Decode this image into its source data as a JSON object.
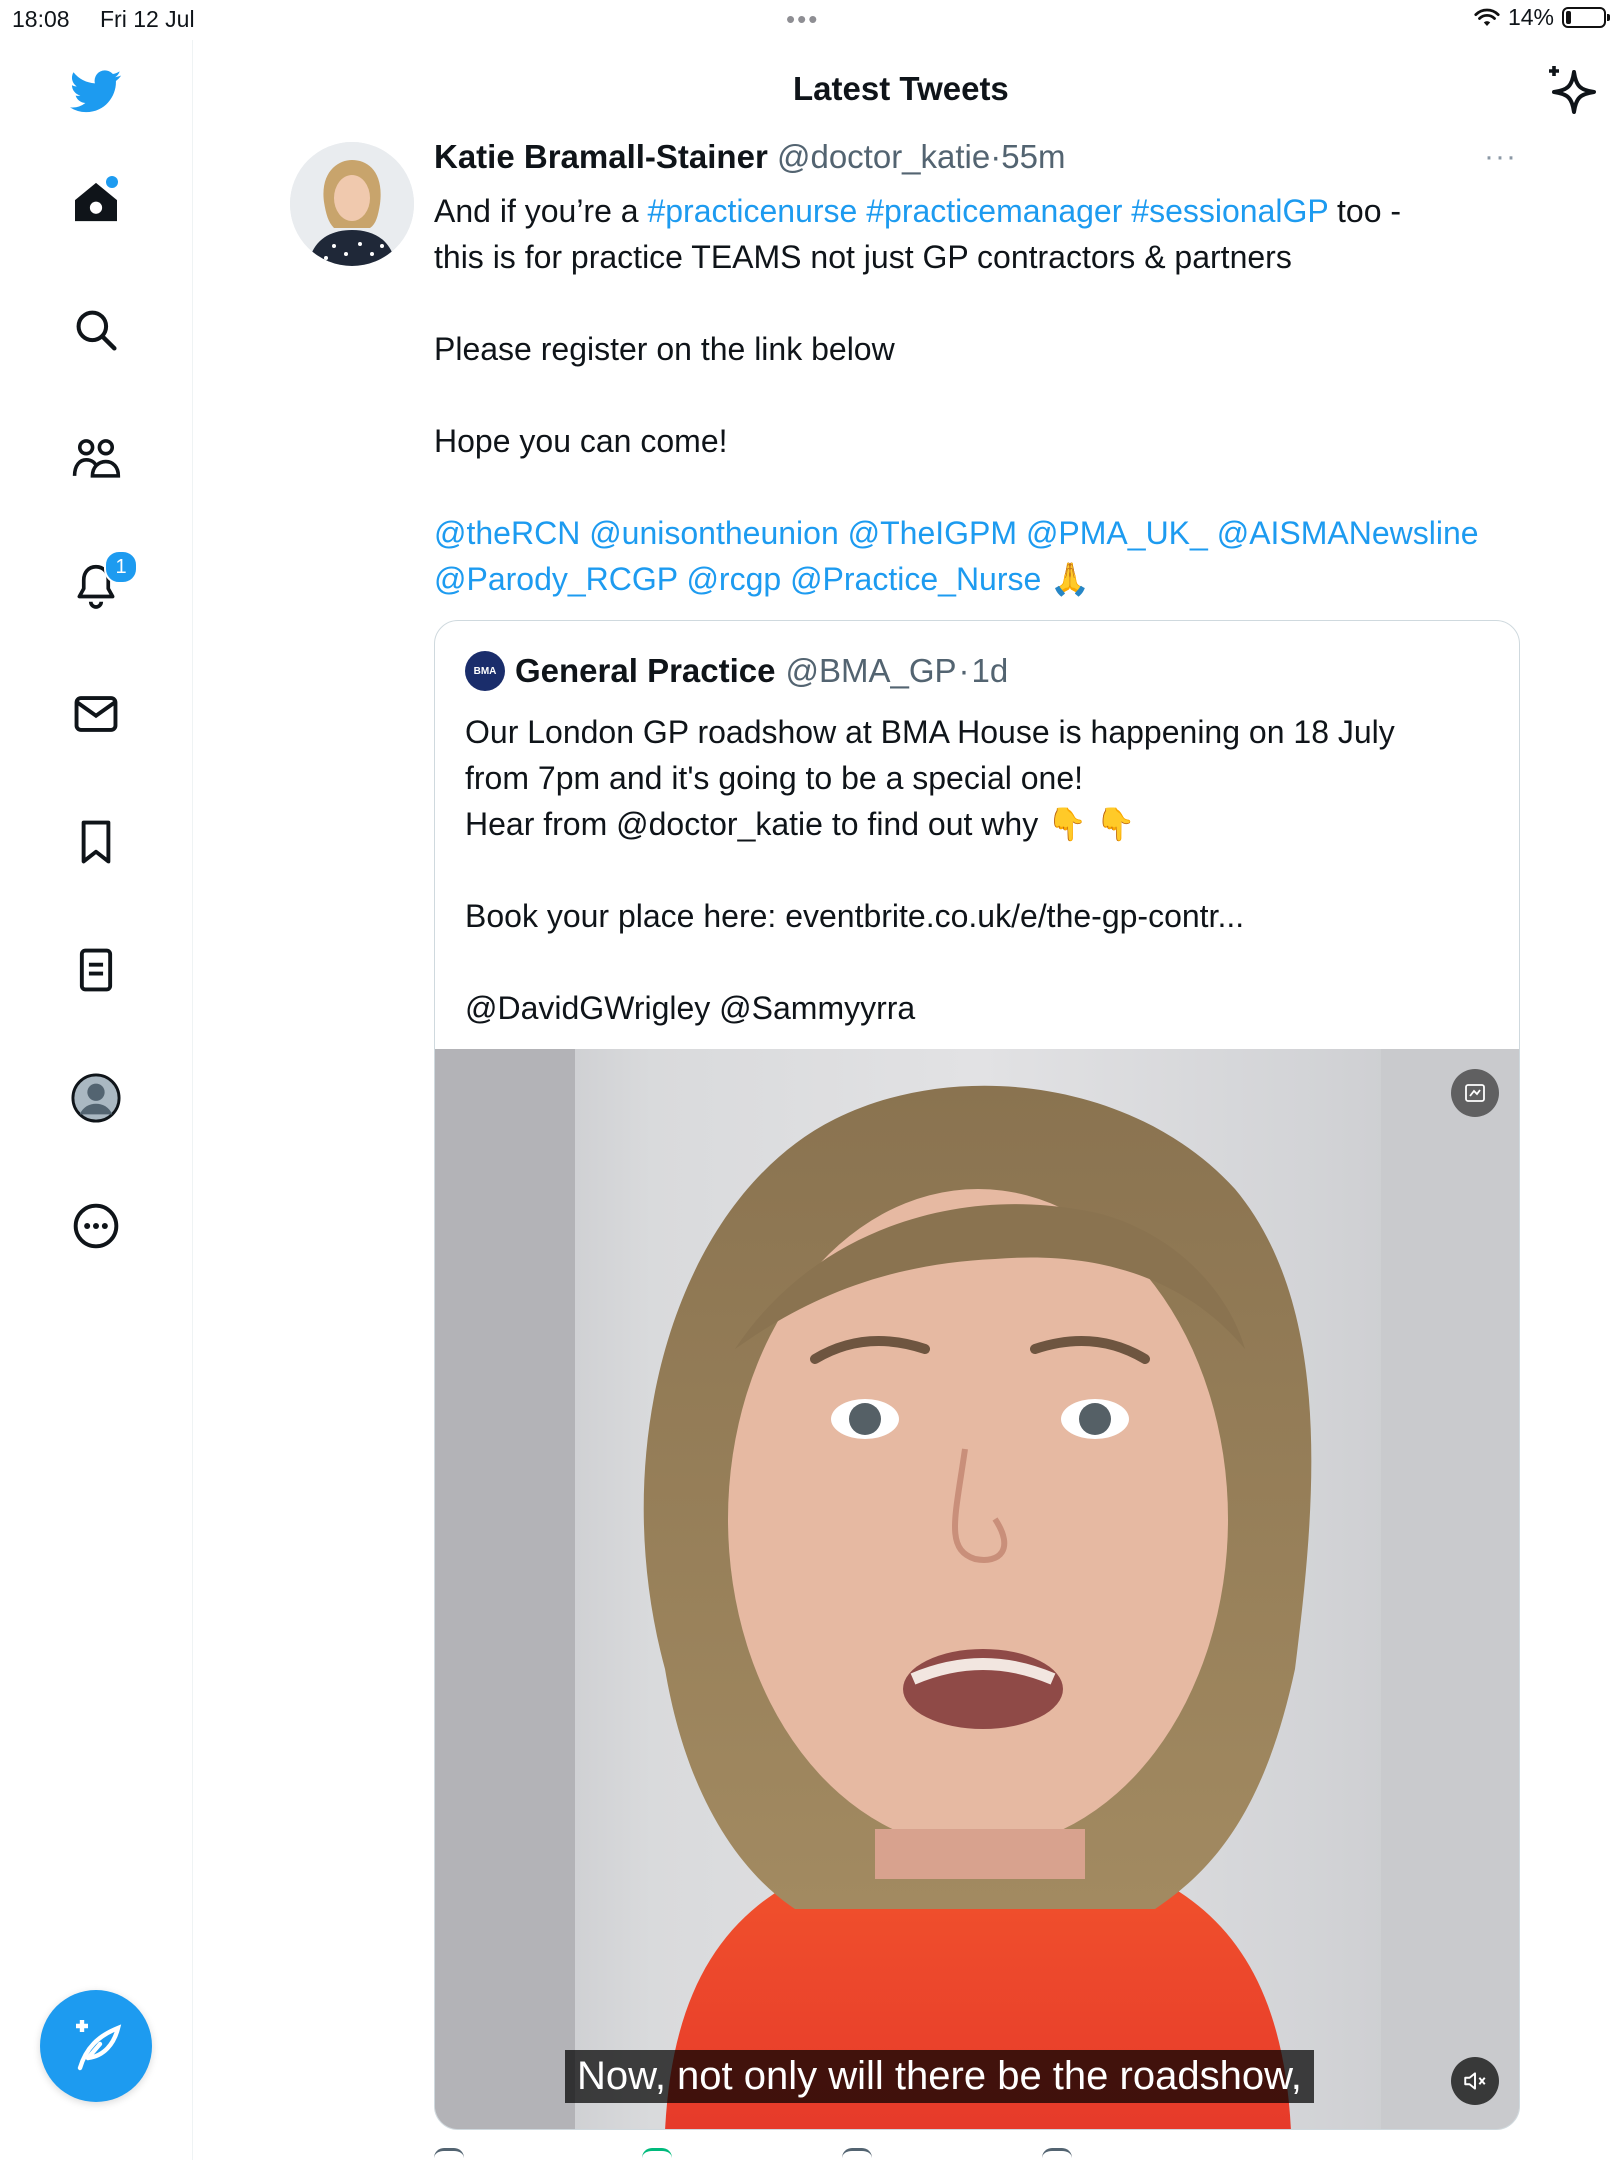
{
  "status_bar": {
    "time": "18:08",
    "date": "Fri 12 Jul",
    "battery_percent": "14%",
    "battery_level": 0.14
  },
  "nav": {
    "notifications_badge": "1",
    "icons": [
      "twitter-logo-icon",
      "home-icon",
      "search-icon",
      "communities-icon",
      "notifications-icon",
      "messages-icon",
      "bookmarks-icon",
      "lists-icon",
      "profile-icon",
      "more-icon",
      "compose-icon"
    ]
  },
  "header": {
    "title": "Latest Tweets"
  },
  "tweet": {
    "author_name": "Katie Bramall-Stainer",
    "author_handle": "@doctor_katie",
    "separator": "·",
    "time": "55m",
    "more": "···",
    "line1_pre": "And if you’re a ",
    "hashtag1": "#practicenurse",
    "hashtag2": "#practicemanager",
    "hashtag3": "#sessionalGP",
    "line1_post": " too -",
    "line2": "this is for practice TEAMS not just GP contractors & partners",
    "line3": "Please register on the link below",
    "line4": "Hope you can come!",
    "mentions_line1": [
      "@theRCN",
      "@unisontheunion",
      "@TheIGPM",
      "@PMA_UK_",
      "@AISMANewsline"
    ],
    "mentions_line2": [
      "@Parody_RCGP",
      "@rcgp",
      "@Practice_Nurse"
    ],
    "emoji": "🙏"
  },
  "quoted": {
    "logo_text": "BMA",
    "name": "General Practice",
    "handle": "@BMA_GP",
    "separator": "·",
    "time": "1d",
    "line1": "Our London GP roadshow at BMA House is happening on 18 July",
    "line2": "from 7pm and it's going to be a special one!",
    "line3": "Hear from @doctor_katie to find out why 👇 👇",
    "line4": "Book your place here: eventbrite.co.uk/e/the-gp-contr...",
    "line5": "@DavidGWrigley @Sammyyrra",
    "video_caption": "Now, not only will there be the roadshow,"
  },
  "colors": {
    "accent": "#1d9bf0",
    "text": "#0f1419",
    "secondary": "#536471",
    "border": "#cfd9de"
  }
}
